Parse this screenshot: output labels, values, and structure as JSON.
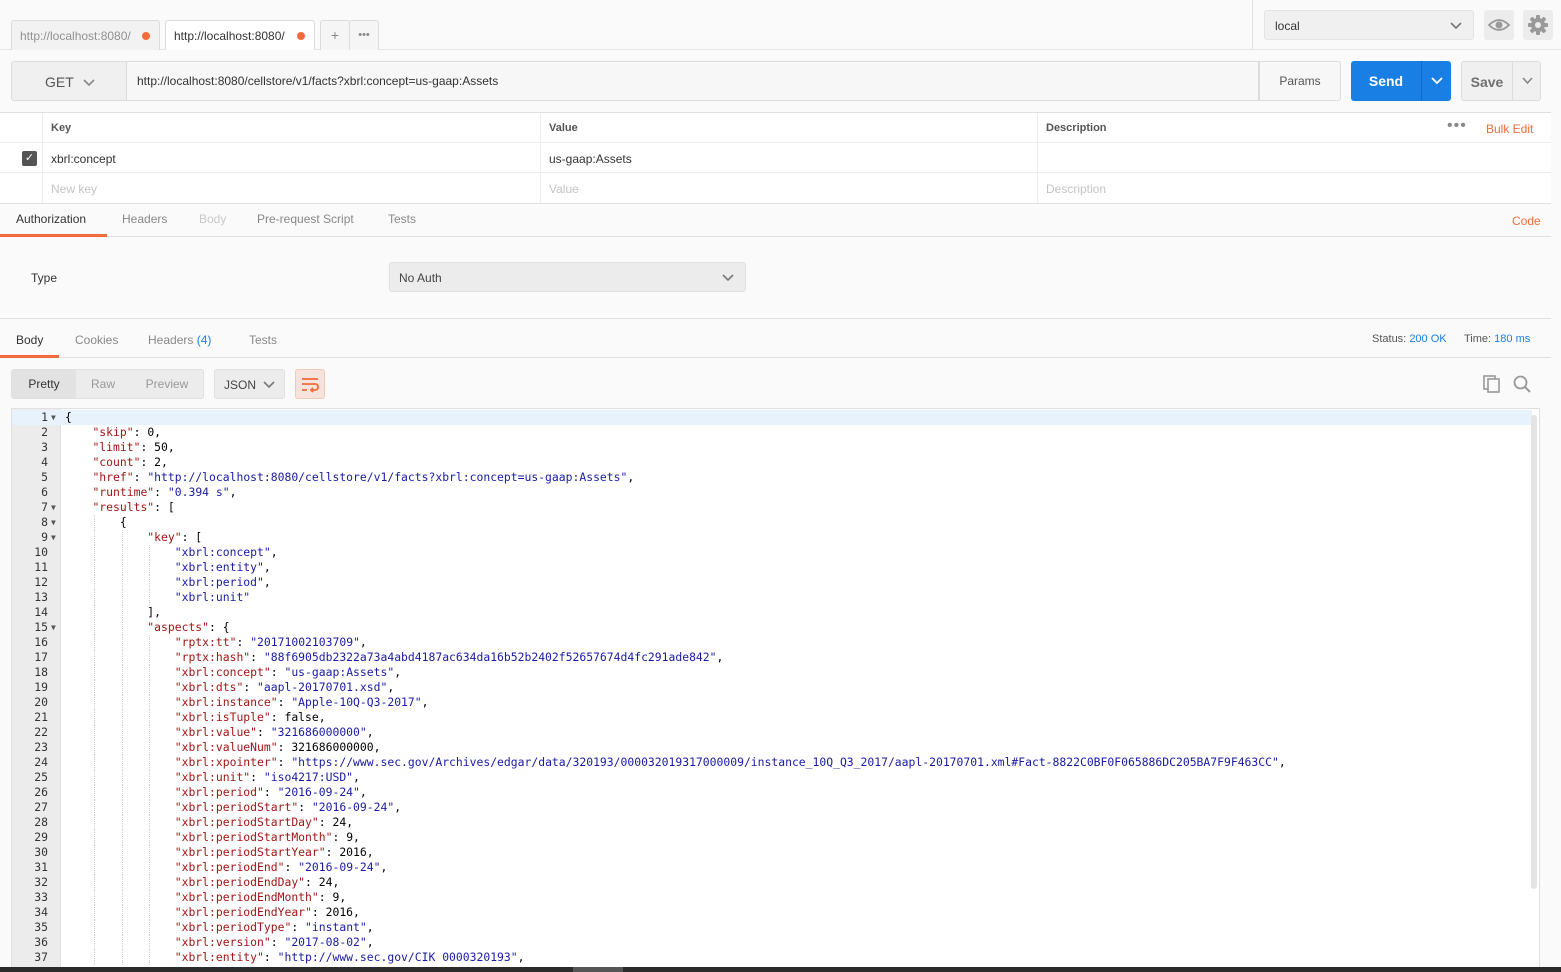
{
  "tabs": [
    {
      "label": "http://localhost:8080/",
      "active": false
    },
    {
      "label": "http://localhost:8080/",
      "active": true
    }
  ],
  "tab_actions": {
    "new_tab_icon": "+",
    "more_icon": "•••"
  },
  "environment": {
    "selected": "local"
  },
  "request": {
    "method": "GET",
    "url": "http://localhost:8080/cellstore/v1/facts?xbrl:concept=us-gaap:Assets",
    "params_label": "Params",
    "send_label": "Send",
    "save_label": "Save"
  },
  "params_table": {
    "headers": {
      "key": "Key",
      "value": "Value",
      "description": "Description"
    },
    "bulk_edit_label": "Bulk Edit",
    "rows": [
      {
        "key": "xbrl:concept",
        "value": "us-gaap:Assets",
        "description": "",
        "checked": true
      }
    ],
    "new_row": {
      "key_placeholder": "New key",
      "value_placeholder": "Value",
      "description_placeholder": "Description"
    }
  },
  "request_tabs": [
    {
      "label": "Authorization",
      "state": "active"
    },
    {
      "label": "Headers",
      "state": "normal"
    },
    {
      "label": "Body",
      "state": "disabled"
    },
    {
      "label": "Pre-request Script",
      "state": "normal"
    },
    {
      "label": "Tests",
      "state": "normal"
    }
  ],
  "code_link": "Code",
  "auth": {
    "type_label": "Type",
    "selected": "No Auth"
  },
  "response_tabs": [
    {
      "label": "Body",
      "count": ""
    },
    {
      "label": "Cookies",
      "count": ""
    },
    {
      "label": "Headers",
      "count": "(4)"
    },
    {
      "label": "Tests",
      "count": ""
    }
  ],
  "response_status": {
    "status_label": "Status:",
    "status_value": "200 OK",
    "time_label": "Time:",
    "time_value": "180 ms"
  },
  "response_view": {
    "modes": [
      "Pretty",
      "Raw",
      "Preview"
    ],
    "active_mode": "Pretty",
    "format": "JSON"
  },
  "colors": {
    "accent": "#f26b3a",
    "primary": "#1a7fe4",
    "json_key": "#a31515",
    "json_string": "#1a1aa6"
  },
  "response_lines": [
    {
      "n": 1,
      "indent": 0,
      "fold": true,
      "parts": [
        [
          "p",
          "{"
        ]
      ]
    },
    {
      "n": 2,
      "indent": 1,
      "parts": [
        [
          "k",
          "\"skip\""
        ],
        [
          "p",
          ": "
        ],
        [
          "n",
          "0"
        ],
        [
          "p",
          ","
        ]
      ]
    },
    {
      "n": 3,
      "indent": 1,
      "parts": [
        [
          "k",
          "\"limit\""
        ],
        [
          "p",
          ": "
        ],
        [
          "n",
          "50"
        ],
        [
          "p",
          ","
        ]
      ]
    },
    {
      "n": 4,
      "indent": 1,
      "parts": [
        [
          "k",
          "\"count\""
        ],
        [
          "p",
          ": "
        ],
        [
          "n",
          "2"
        ],
        [
          "p",
          ","
        ]
      ]
    },
    {
      "n": 5,
      "indent": 1,
      "parts": [
        [
          "k",
          "\"href\""
        ],
        [
          "p",
          ": "
        ],
        [
          "s",
          "\"http://localhost:8080/cellstore/v1/facts?xbrl:concept=us-gaap:Assets\""
        ],
        [
          "p",
          ","
        ]
      ]
    },
    {
      "n": 6,
      "indent": 1,
      "parts": [
        [
          "k",
          "\"runtime\""
        ],
        [
          "p",
          ": "
        ],
        [
          "s",
          "\"0.394 s\""
        ],
        [
          "p",
          ","
        ]
      ]
    },
    {
      "n": 7,
      "indent": 1,
      "fold": true,
      "parts": [
        [
          "k",
          "\"results\""
        ],
        [
          "p",
          ": ["
        ]
      ]
    },
    {
      "n": 8,
      "indent": 2,
      "fold": true,
      "parts": [
        [
          "p",
          "{"
        ]
      ]
    },
    {
      "n": 9,
      "indent": 3,
      "fold": true,
      "parts": [
        [
          "k",
          "\"key\""
        ],
        [
          "p",
          ": ["
        ]
      ]
    },
    {
      "n": 10,
      "indent": 4,
      "parts": [
        [
          "s",
          "\"xbrl:concept\""
        ],
        [
          "p",
          ","
        ]
      ]
    },
    {
      "n": 11,
      "indent": 4,
      "parts": [
        [
          "s",
          "\"xbrl:entity\""
        ],
        [
          "p",
          ","
        ]
      ]
    },
    {
      "n": 12,
      "indent": 4,
      "parts": [
        [
          "s",
          "\"xbrl:period\""
        ],
        [
          "p",
          ","
        ]
      ]
    },
    {
      "n": 13,
      "indent": 4,
      "parts": [
        [
          "s",
          "\"xbrl:unit\""
        ]
      ]
    },
    {
      "n": 14,
      "indent": 3,
      "parts": [
        [
          "p",
          "],"
        ]
      ]
    },
    {
      "n": 15,
      "indent": 3,
      "fold": true,
      "parts": [
        [
          "k",
          "\"aspects\""
        ],
        [
          "p",
          ": {"
        ]
      ]
    },
    {
      "n": 16,
      "indent": 4,
      "parts": [
        [
          "k",
          "\"rptx:tt\""
        ],
        [
          "p",
          ": "
        ],
        [
          "s",
          "\"20171002103709\""
        ],
        [
          "p",
          ","
        ]
      ]
    },
    {
      "n": 17,
      "indent": 4,
      "parts": [
        [
          "k",
          "\"rptx:hash\""
        ],
        [
          "p",
          ": "
        ],
        [
          "s",
          "\"88f6905db2322a73a4abd4187ac634da16b52b2402f52657674d4fc291ade842\""
        ],
        [
          "p",
          ","
        ]
      ]
    },
    {
      "n": 18,
      "indent": 4,
      "parts": [
        [
          "k",
          "\"xbrl:concept\""
        ],
        [
          "p",
          ": "
        ],
        [
          "s",
          "\"us-gaap:Assets\""
        ],
        [
          "p",
          ","
        ]
      ]
    },
    {
      "n": 19,
      "indent": 4,
      "parts": [
        [
          "k",
          "\"xbrl:dts\""
        ],
        [
          "p",
          ": "
        ],
        [
          "s",
          "\"aapl-20170701.xsd\""
        ],
        [
          "p",
          ","
        ]
      ]
    },
    {
      "n": 20,
      "indent": 4,
      "parts": [
        [
          "k",
          "\"xbrl:instance\""
        ],
        [
          "p",
          ": "
        ],
        [
          "s",
          "\"Apple-10Q-Q3-2017\""
        ],
        [
          "p",
          ","
        ]
      ]
    },
    {
      "n": 21,
      "indent": 4,
      "parts": [
        [
          "k",
          "\"xbrl:isTuple\""
        ],
        [
          "p",
          ": "
        ],
        [
          "n",
          "false"
        ],
        [
          "p",
          ","
        ]
      ]
    },
    {
      "n": 22,
      "indent": 4,
      "parts": [
        [
          "k",
          "\"xbrl:value\""
        ],
        [
          "p",
          ": "
        ],
        [
          "s",
          "\"321686000000\""
        ],
        [
          "p",
          ","
        ]
      ]
    },
    {
      "n": 23,
      "indent": 4,
      "parts": [
        [
          "k",
          "\"xbrl:valueNum\""
        ],
        [
          "p",
          ": "
        ],
        [
          "n",
          "321686000000"
        ],
        [
          "p",
          ","
        ]
      ]
    },
    {
      "n": 24,
      "indent": 4,
      "parts": [
        [
          "k",
          "\"xbrl:xpointer\""
        ],
        [
          "p",
          ": "
        ],
        [
          "s",
          "\"https://www.sec.gov/Archives/edgar/data/320193/000032019317000009/instance_10Q_Q3_2017/aapl-20170701.xml#Fact-8822C0BF0F065886DC205BA7F9F463CC\""
        ],
        [
          "p",
          ","
        ]
      ]
    },
    {
      "n": 25,
      "indent": 4,
      "parts": [
        [
          "k",
          "\"xbrl:unit\""
        ],
        [
          "p",
          ": "
        ],
        [
          "s",
          "\"iso4217:USD\""
        ],
        [
          "p",
          ","
        ]
      ]
    },
    {
      "n": 26,
      "indent": 4,
      "parts": [
        [
          "k",
          "\"xbrl:period\""
        ],
        [
          "p",
          ": "
        ],
        [
          "s",
          "\"2016-09-24\""
        ],
        [
          "p",
          ","
        ]
      ]
    },
    {
      "n": 27,
      "indent": 4,
      "parts": [
        [
          "k",
          "\"xbrl:periodStart\""
        ],
        [
          "p",
          ": "
        ],
        [
          "s",
          "\"2016-09-24\""
        ],
        [
          "p",
          ","
        ]
      ]
    },
    {
      "n": 28,
      "indent": 4,
      "parts": [
        [
          "k",
          "\"xbrl:periodStartDay\""
        ],
        [
          "p",
          ": "
        ],
        [
          "n",
          "24"
        ],
        [
          "p",
          ","
        ]
      ]
    },
    {
      "n": 29,
      "indent": 4,
      "parts": [
        [
          "k",
          "\"xbrl:periodStartMonth\""
        ],
        [
          "p",
          ": "
        ],
        [
          "n",
          "9"
        ],
        [
          "p",
          ","
        ]
      ]
    },
    {
      "n": 30,
      "indent": 4,
      "parts": [
        [
          "k",
          "\"xbrl:periodStartYear\""
        ],
        [
          "p",
          ": "
        ],
        [
          "n",
          "2016"
        ],
        [
          "p",
          ","
        ]
      ]
    },
    {
      "n": 31,
      "indent": 4,
      "parts": [
        [
          "k",
          "\"xbrl:periodEnd\""
        ],
        [
          "p",
          ": "
        ],
        [
          "s",
          "\"2016-09-24\""
        ],
        [
          "p",
          ","
        ]
      ]
    },
    {
      "n": 32,
      "indent": 4,
      "parts": [
        [
          "k",
          "\"xbrl:periodEndDay\""
        ],
        [
          "p",
          ": "
        ],
        [
          "n",
          "24"
        ],
        [
          "p",
          ","
        ]
      ]
    },
    {
      "n": 33,
      "indent": 4,
      "parts": [
        [
          "k",
          "\"xbrl:periodEndMonth\""
        ],
        [
          "p",
          ": "
        ],
        [
          "n",
          "9"
        ],
        [
          "p",
          ","
        ]
      ]
    },
    {
      "n": 34,
      "indent": 4,
      "parts": [
        [
          "k",
          "\"xbrl:periodEndYear\""
        ],
        [
          "p",
          ": "
        ],
        [
          "n",
          "2016"
        ],
        [
          "p",
          ","
        ]
      ]
    },
    {
      "n": 35,
      "indent": 4,
      "parts": [
        [
          "k",
          "\"xbrl:periodType\""
        ],
        [
          "p",
          ": "
        ],
        [
          "s",
          "\"instant\""
        ],
        [
          "p",
          ","
        ]
      ]
    },
    {
      "n": 36,
      "indent": 4,
      "parts": [
        [
          "k",
          "\"xbrl:version\""
        ],
        [
          "p",
          ": "
        ],
        [
          "s",
          "\"2017-08-02\""
        ],
        [
          "p",
          ","
        ]
      ]
    },
    {
      "n": 37,
      "indent": 4,
      "parts": [
        [
          "k",
          "\"xbrl:entity\""
        ],
        [
          "p",
          ": "
        ],
        [
          "s",
          "\"http://www.sec.gov/CIK 0000320193\""
        ],
        [
          "p",
          ","
        ]
      ]
    }
  ]
}
